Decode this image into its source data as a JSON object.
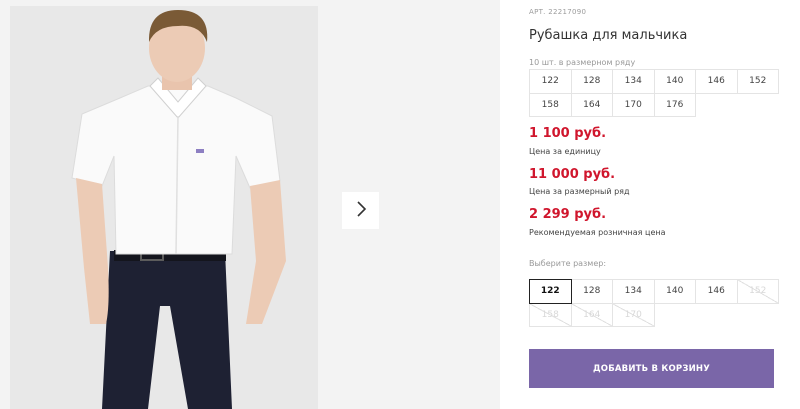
{
  "product": {
    "sku": "АРТ. 22217090",
    "title": "Рубашка для мальчика",
    "pack_note": "10 шт. в размерном ряду"
  },
  "pack_sizes": [
    "122",
    "128",
    "134",
    "140",
    "146",
    "152",
    "158",
    "164",
    "170",
    "176"
  ],
  "prices": [
    {
      "value": "1 100 руб.",
      "label": "Цена за единицу"
    },
    {
      "value": "11 000 руб.",
      "label": "Цена за размерный ряд"
    },
    {
      "value": "2 299 руб.",
      "label": "Рекомендуемая розничная цена"
    }
  ],
  "size_selector": {
    "label": "Выберите размер:",
    "sizes": [
      {
        "value": "122",
        "state": "selected"
      },
      {
        "value": "128",
        "state": "available"
      },
      {
        "value": "134",
        "state": "available"
      },
      {
        "value": "140",
        "state": "available"
      },
      {
        "value": "146",
        "state": "available"
      },
      {
        "value": "152",
        "state": "unavailable"
      },
      {
        "value": "158",
        "state": "unavailable"
      },
      {
        "value": "164",
        "state": "unavailable"
      },
      {
        "value": "170",
        "state": "unavailable"
      }
    ]
  },
  "cart_button": {
    "label": "ДОБАВИТЬ В КОРЗИНУ"
  },
  "gallery": {
    "next_icon": "chevron-right-icon"
  },
  "colors": {
    "price": "#d0162d",
    "button": "#7a66a8"
  }
}
